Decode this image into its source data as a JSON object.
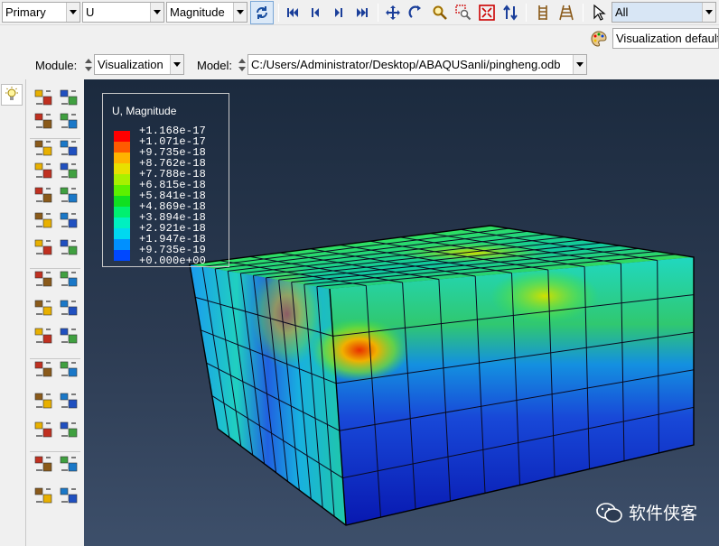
{
  "toolbar": {
    "display_group": "Primary",
    "field_variable": "U",
    "component": "Magnitude",
    "selection_filter": "All",
    "render_style": "Visualization defaults"
  },
  "context": {
    "module_label": "Module:",
    "module_value": "Visualization",
    "model_label": "Model:",
    "model_value": "C:/Users/Administrator/Desktop/ABAQUSanli/pingheng.odb"
  },
  "legend": {
    "title": "U, Magnitude",
    "values": [
      "+1.168e-17",
      "+1.071e-17",
      "+9.735e-18",
      "+8.762e-18",
      "+7.788e-18",
      "+6.815e-18",
      "+5.841e-18",
      "+4.869e-18",
      "+3.894e-18",
      "+2.921e-18",
      "+1.947e-18",
      "+9.735e-19",
      "+0.000e+00"
    ],
    "colors": [
      "#ff0000",
      "#ff5a00",
      "#ffb300",
      "#e8e000",
      "#a8f000",
      "#5cf000",
      "#10e020",
      "#00f070",
      "#00f0c0",
      "#00d8f0",
      "#0090ff",
      "#0048ff",
      "#0000e8"
    ]
  },
  "watermark": {
    "text": "软件侠客"
  }
}
